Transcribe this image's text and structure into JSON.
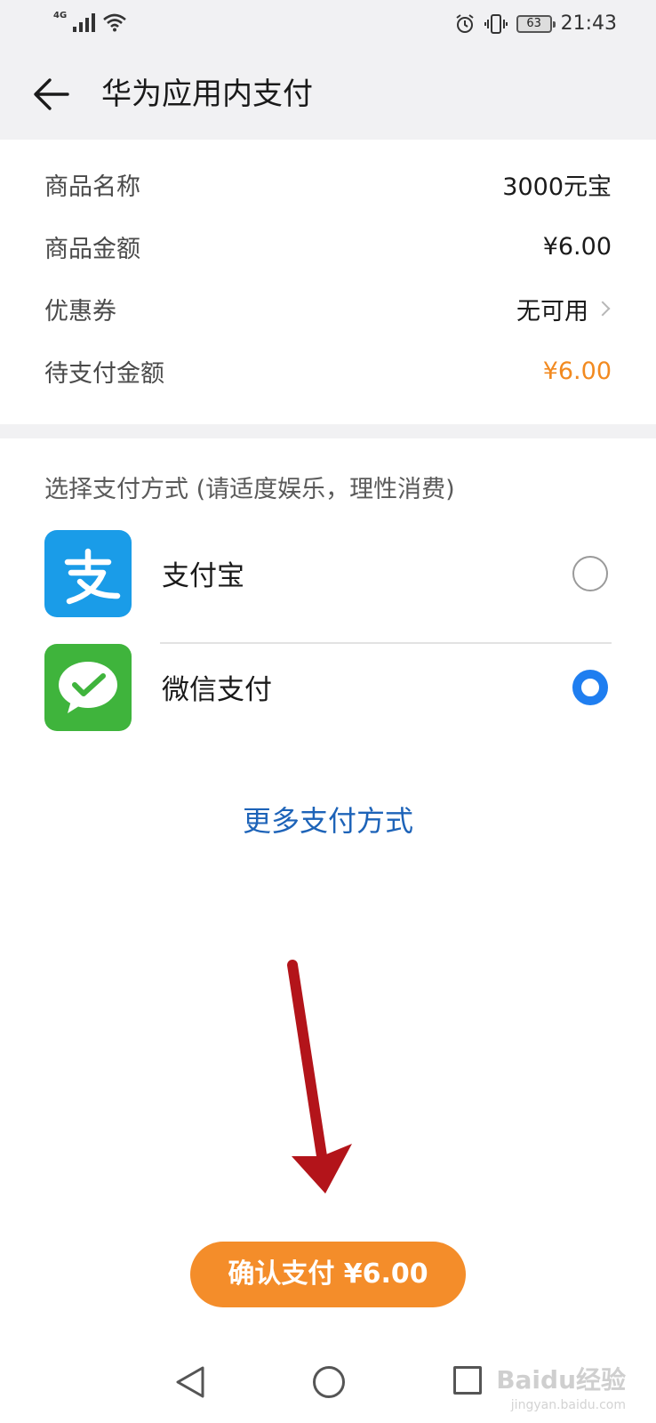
{
  "status_bar": {
    "network": "4G",
    "battery": "63",
    "time": "21:43"
  },
  "header": {
    "title": "华为应用内支付"
  },
  "order": {
    "rows": [
      {
        "label": "商品名称",
        "value": "3000元宝"
      },
      {
        "label": "商品金额",
        "value": "¥6.00"
      },
      {
        "label": "优惠券",
        "value": "无可用"
      },
      {
        "label": "待支付金额",
        "value": "¥6.00"
      }
    ]
  },
  "payment": {
    "section_title": "选择支付方式 (请适度娱乐，理性消费)",
    "methods": [
      {
        "label": "支付宝",
        "icon": "alipay-icon",
        "selected": false
      },
      {
        "label": "微信支付",
        "icon": "wechat-pay-icon",
        "selected": true
      }
    ],
    "more_label": "更多支付方式"
  },
  "confirm_button": {
    "label": "确认支付 ¥6.00"
  },
  "watermark": {
    "main": "Baidu经验",
    "sub": "jingyan.baidu.com"
  },
  "colors": {
    "accent_orange": "#f48d2a",
    "price_orange": "#f28a20",
    "link_blue": "#1d63b8",
    "radio_blue": "#1f7ef0",
    "alipay_blue": "#1a9ce8",
    "wechat_green": "#3fb43c",
    "annotation_arrow": "#b3141a"
  }
}
